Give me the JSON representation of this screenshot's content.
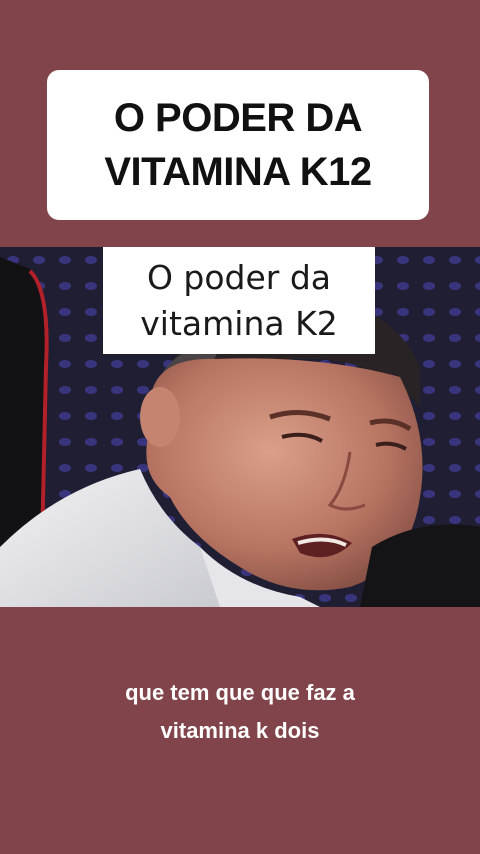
{
  "title_card": {
    "line1": "O PODER DA",
    "line2": "VITAMINA K12"
  },
  "video": {
    "caption_line1": "O poder da",
    "caption_line2": "vitamina K2"
  },
  "subtitle": {
    "line1": "que tem que que faz a",
    "line2": "vitamina k dois"
  },
  "colors": {
    "background": "#81444a",
    "title_card": "#ffffff",
    "subtitle_text": "#ffffff"
  }
}
